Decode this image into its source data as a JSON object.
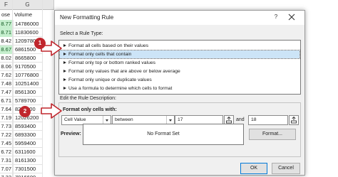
{
  "sheet": {
    "columns": [
      "F",
      "G"
    ],
    "header": {
      "f": "ose",
      "g": "Volume"
    },
    "rows": [
      {
        "f": "8.77",
        "g": "14786000",
        "hl": true
      },
      {
        "f": "8.71",
        "g": "11830600",
        "hl": true
      },
      {
        "f": "8.42",
        "g": "12097800",
        "hl": false
      },
      {
        "f": "8.67",
        "g": "6861500",
        "hl": true
      },
      {
        "f": "8.02",
        "g": "8665800",
        "hl": false
      },
      {
        "f": "8.06",
        "g": "9170500",
        "hl": false
      },
      {
        "f": "7.62",
        "g": "10776800",
        "hl": false
      },
      {
        "f": "7.48",
        "g": "10251400",
        "hl": false
      },
      {
        "f": "7.47",
        "g": "8561300",
        "hl": false
      },
      {
        "f": "6.71",
        "g": "5789700",
        "hl": false
      },
      {
        "f": "7.64",
        "g": "8221100",
        "hl": false
      },
      {
        "f": "7.19",
        "g": "12026200",
        "hl": false
      },
      {
        "f": "7.73",
        "g": "8593400",
        "hl": false
      },
      {
        "f": "7.22",
        "g": "6893300",
        "hl": false
      },
      {
        "f": "7.45",
        "g": "5959400",
        "hl": false
      },
      {
        "f": "6.72",
        "g": "6311600",
        "hl": false
      },
      {
        "f": "7.31",
        "g": "8161300",
        "hl": false
      },
      {
        "f": "7.07",
        "g": "7301500",
        "hl": false
      },
      {
        "f": "7.32",
        "g": "7016600",
        "hl": false
      }
    ],
    "highlight_color": "#c6efce"
  },
  "dialog": {
    "title": "New Formatting Rule",
    "help_label": "?",
    "select_type_label": "Select a Rule Type:",
    "rule_types": [
      "Format all cells based on their values",
      "Format only cells that contain",
      "Format only top or bottom ranked values",
      "Format only values that are above or below average",
      "Format only unique or duplicate values",
      "Use a formula to determine which cells to format"
    ],
    "selected_rule_index": 1,
    "edit_desc_label": "Edit the Rule Description:",
    "format_only_label": "Format only cells with:",
    "condition": {
      "field": "Cell Value",
      "operator": "between",
      "value1": "17",
      "and_label": "and",
      "value2": "18"
    },
    "preview_label": "Preview:",
    "preview_text": "No Format Set",
    "format_button": "Format...",
    "ok_button": "OK",
    "cancel_button": "Cancel"
  },
  "callouts": [
    {
      "number": "1"
    },
    {
      "number": "2"
    }
  ],
  "colors": {
    "callout": "#c0262d",
    "selection": "#cce4f7",
    "ok_border": "#0078d7"
  }
}
